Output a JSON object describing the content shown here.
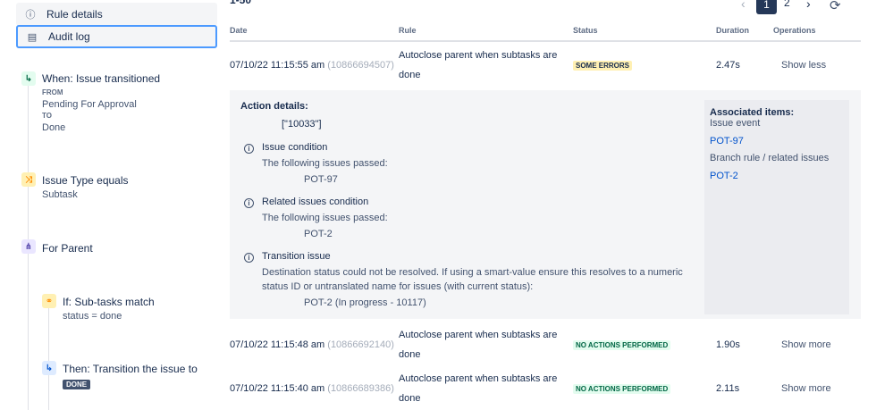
{
  "nav": {
    "rule_details": "Rule details",
    "audit_log": "Audit log"
  },
  "components": {
    "trigger": {
      "title": "When: Issue transitioned",
      "from_label": "FROM",
      "from_value": "Pending For Approval",
      "to_label": "TO",
      "to_value": "Done"
    },
    "condition": {
      "title": "Issue Type equals",
      "value": "Subtask"
    },
    "branch": {
      "title": "For Parent"
    },
    "if": {
      "title": "If: Sub-tasks match",
      "value": "status = done"
    },
    "action": {
      "title": "Then: Transition the issue to",
      "value": "DONE"
    }
  },
  "header": {
    "range": "1-50",
    "pages": [
      "1",
      "2"
    ],
    "columns": {
      "date": "Date",
      "rule": "Rule",
      "status": "Status",
      "duration": "Duration",
      "operations": "Operations"
    }
  },
  "rows": [
    {
      "date": "07/10/22 11:15:55 am",
      "id": "(10866694507)",
      "rule_line1": "Autoclose parent when subtasks are",
      "rule_line2": "done",
      "status": "SOME ERRORS",
      "duration": "2.47s",
      "op": "Show less"
    },
    {
      "date": "07/10/22 11:15:48 am",
      "id": "(10866692140)",
      "rule_line1": "Autoclose parent when subtasks are",
      "rule_line2": "done",
      "status": "NO ACTIONS PERFORMED",
      "duration": "1.90s",
      "op": "Show more"
    },
    {
      "date": "07/10/22 11:15:40 am",
      "id": "(10866689386)",
      "rule_line1": "Autoclose parent when subtasks are",
      "rule_line2": "done",
      "status": "NO ACTIONS PERFORMED",
      "duration": "2.11s",
      "op": "Show more"
    }
  ],
  "details": {
    "heading": "Action details:",
    "value": "[\"10033\"]",
    "items": [
      {
        "title": "Issue condition",
        "sub": "The following issues passed:",
        "value": "POT-97"
      },
      {
        "title": "Related issues condition",
        "sub": "The following issues passed:",
        "value": "POT-2"
      },
      {
        "title": "Transition issue",
        "sub": "Destination status could not be resolved. If using a smart-value ensure this resolves to a numeric",
        "sub2": "status ID or untranslated name for issues (with current status):",
        "value": "POT-2 (In progress - 10117)"
      }
    ],
    "assoc": {
      "heading": "Associated items:",
      "event_label": "Issue event",
      "event_link": "POT-97",
      "branch_label": "Branch rule / related issues",
      "branch_link": "POT-2"
    }
  }
}
